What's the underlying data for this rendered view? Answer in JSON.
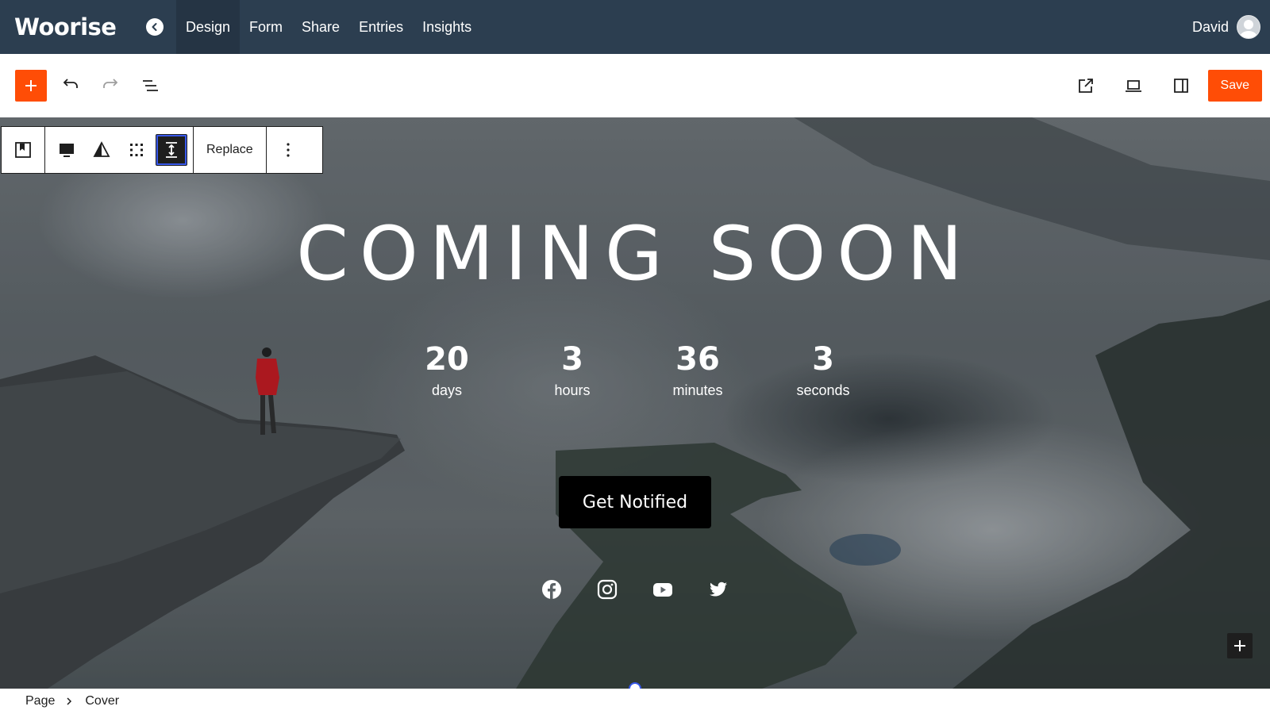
{
  "app": {
    "logo": "Woorise",
    "tabs": [
      {
        "label": "Design",
        "active": true
      },
      {
        "label": "Form"
      },
      {
        "label": "Share"
      },
      {
        "label": "Entries"
      },
      {
        "label": "Insights"
      }
    ],
    "user_name": "David"
  },
  "toolbar": {
    "save_label": "Save",
    "accent_color": "#ff4d06"
  },
  "block_toolbar": {
    "replace_label": "Replace"
  },
  "cover": {
    "heading": "COMING SOON",
    "countdown": [
      {
        "value": "20",
        "label": "days"
      },
      {
        "value": "3",
        "label": "hours"
      },
      {
        "value": "36",
        "label": "minutes"
      },
      {
        "value": "3",
        "label": "seconds"
      }
    ],
    "button_label": "Get Notified",
    "socials": [
      "facebook-icon",
      "instagram-icon",
      "youtube-icon",
      "twitter-icon"
    ]
  },
  "breadcrumb": [
    "Page",
    "Cover"
  ],
  "colors": {
    "nav_bg": "#2c3e50",
    "accent": "#ff4d06",
    "selection": "#3858e9"
  }
}
